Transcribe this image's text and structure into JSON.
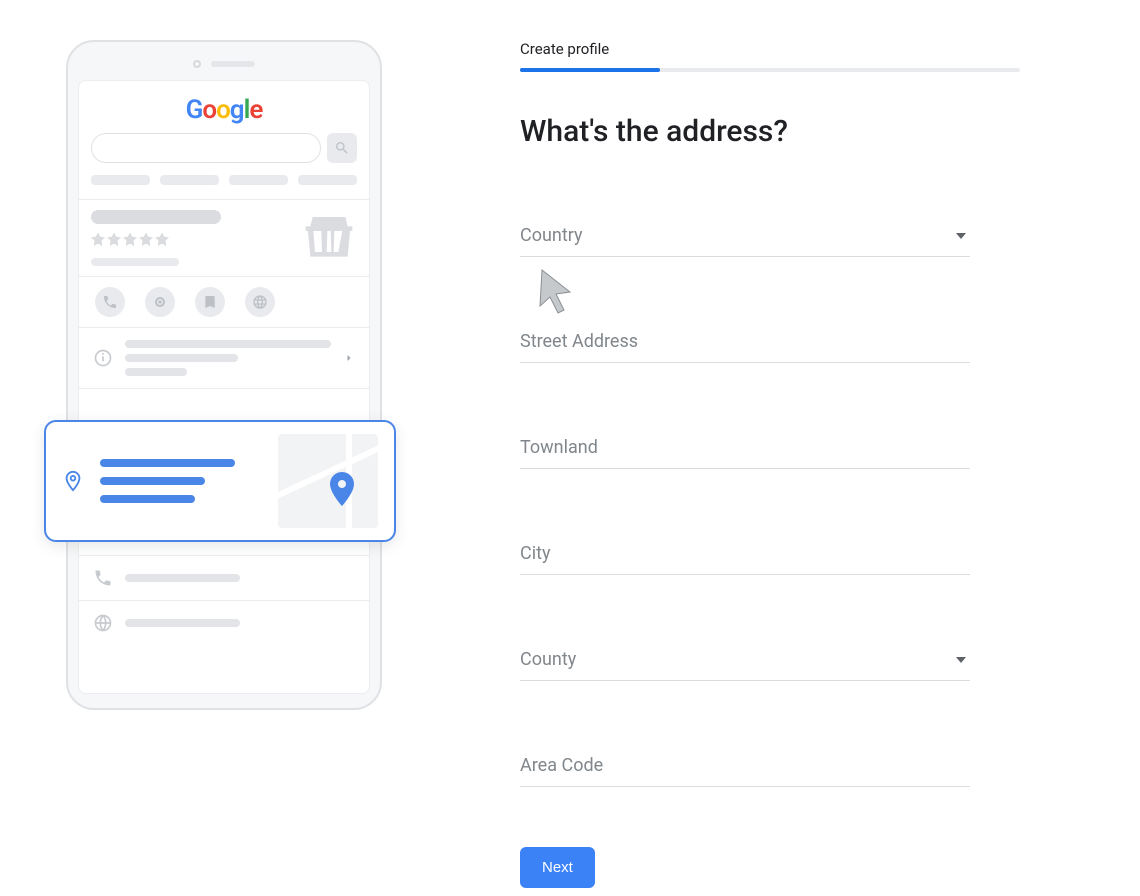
{
  "step_label": "Create profile",
  "title": "What's the address?",
  "fields": {
    "country": {
      "label": "Country"
    },
    "street": {
      "label": "Street Address"
    },
    "townland": {
      "label": "Townland"
    },
    "city": {
      "label": "City"
    },
    "county": {
      "label": "County"
    },
    "areacode": {
      "label": "Area Code"
    }
  },
  "next_button": "Next",
  "logo": {
    "g1": "G",
    "o1": "o",
    "o2": "o",
    "g2": "g",
    "l": "l",
    "e": "e"
  }
}
